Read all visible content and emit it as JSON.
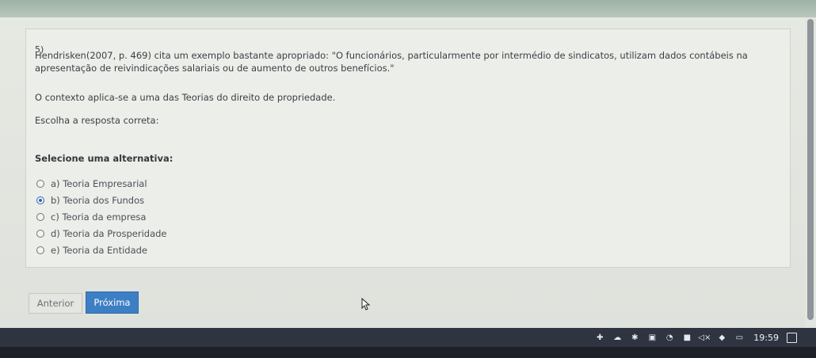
{
  "question": {
    "number": "5)",
    "text": "Hendrisken(2007, p. 469) cita um exemplo bastante apropriado: \"O funcionários, particularmente  por intermédio de sindicatos, utilizam dados contábeis na apresentação de reivindicações salariais ou de aumento de outros benefícios.\"",
    "context": "O contexto aplica-se a uma das Teorias do direito de propriedade.",
    "instruction": "Escolha a resposta correta:"
  },
  "answers": {
    "label": "Selecione uma alternativa:",
    "options": [
      {
        "label": "a) Teoria Empresarial",
        "selected": false
      },
      {
        "label": "b) Teoria dos Fundos",
        "selected": true
      },
      {
        "label": "c) Teoria da empresa",
        "selected": false
      },
      {
        "label": "d) Teoria da Prosperidade",
        "selected": false
      },
      {
        "label": "e) Teoria da Entidade",
        "selected": false
      }
    ]
  },
  "nav": {
    "prev_label": "Anterior",
    "next_label": "Próxima"
  },
  "taskbar": {
    "time": "19:59",
    "icons": [
      "network-icon",
      "cloud-icon",
      "puzzle-icon",
      "app-icon",
      "wifi-icon",
      "antivirus-icon",
      "volume-muted-icon",
      "security-icon",
      "battery-icon",
      "notification-icon"
    ]
  },
  "colors": {
    "accent": "#3d7fc4",
    "page_bg": "#e6e8e2",
    "taskbar": "#2e3440"
  }
}
